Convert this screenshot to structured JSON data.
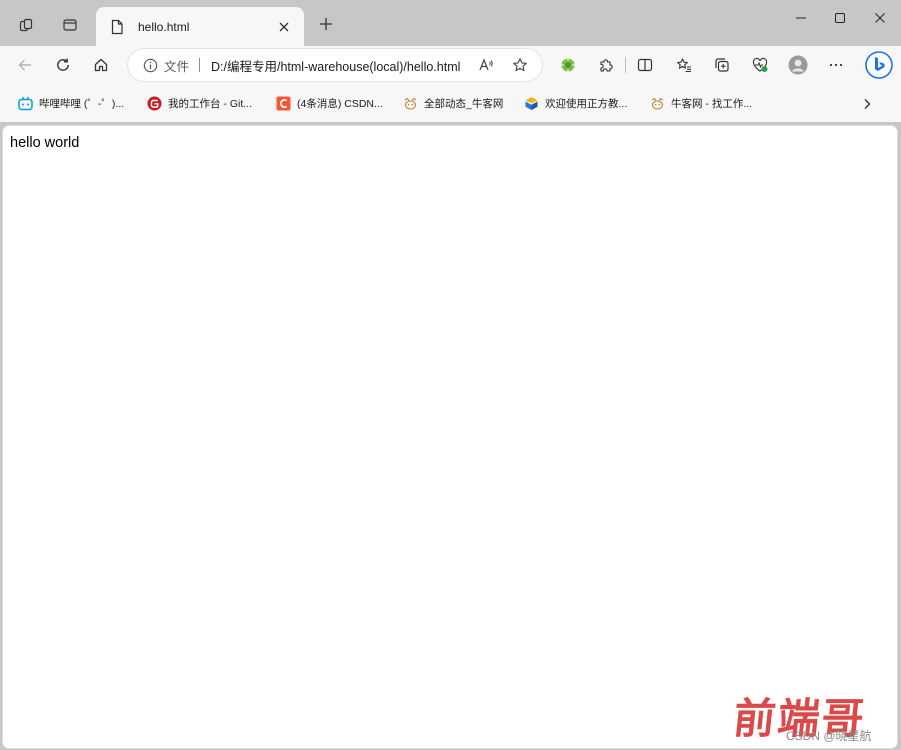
{
  "browser": {
    "tab": {
      "title": "hello.html"
    },
    "address": {
      "scheme_label": "文件",
      "url": "D:/编程专用/html-warehouse(local)/hello.html"
    },
    "bookmarks": [
      {
        "label": "哔哩哔哩 (゜-゜)...",
        "icon": "bilibili-icon"
      },
      {
        "label": "我的工作台 - Git...",
        "icon": "gitee-icon"
      },
      {
        "label": "(4条消息) CSDN...",
        "icon": "csdn-icon"
      },
      {
        "label": "全部动态_牛客网",
        "icon": "nowcoder-icon"
      },
      {
        "label": "欢迎使用正方教...",
        "icon": "zhengfang-icon"
      },
      {
        "label": "牛客网 - 找工作...",
        "icon": "nowcoder-icon"
      }
    ]
  },
  "page": {
    "body_text": "hello world"
  },
  "watermark": {
    "logo": "前端哥",
    "credit": "CSDN @晓星航"
  },
  "colors": {
    "accent": "#1a73e8",
    "logo_red": "#d93a3a",
    "chrome": "#c7c7c7",
    "toolbar": "#f7f7f7"
  }
}
